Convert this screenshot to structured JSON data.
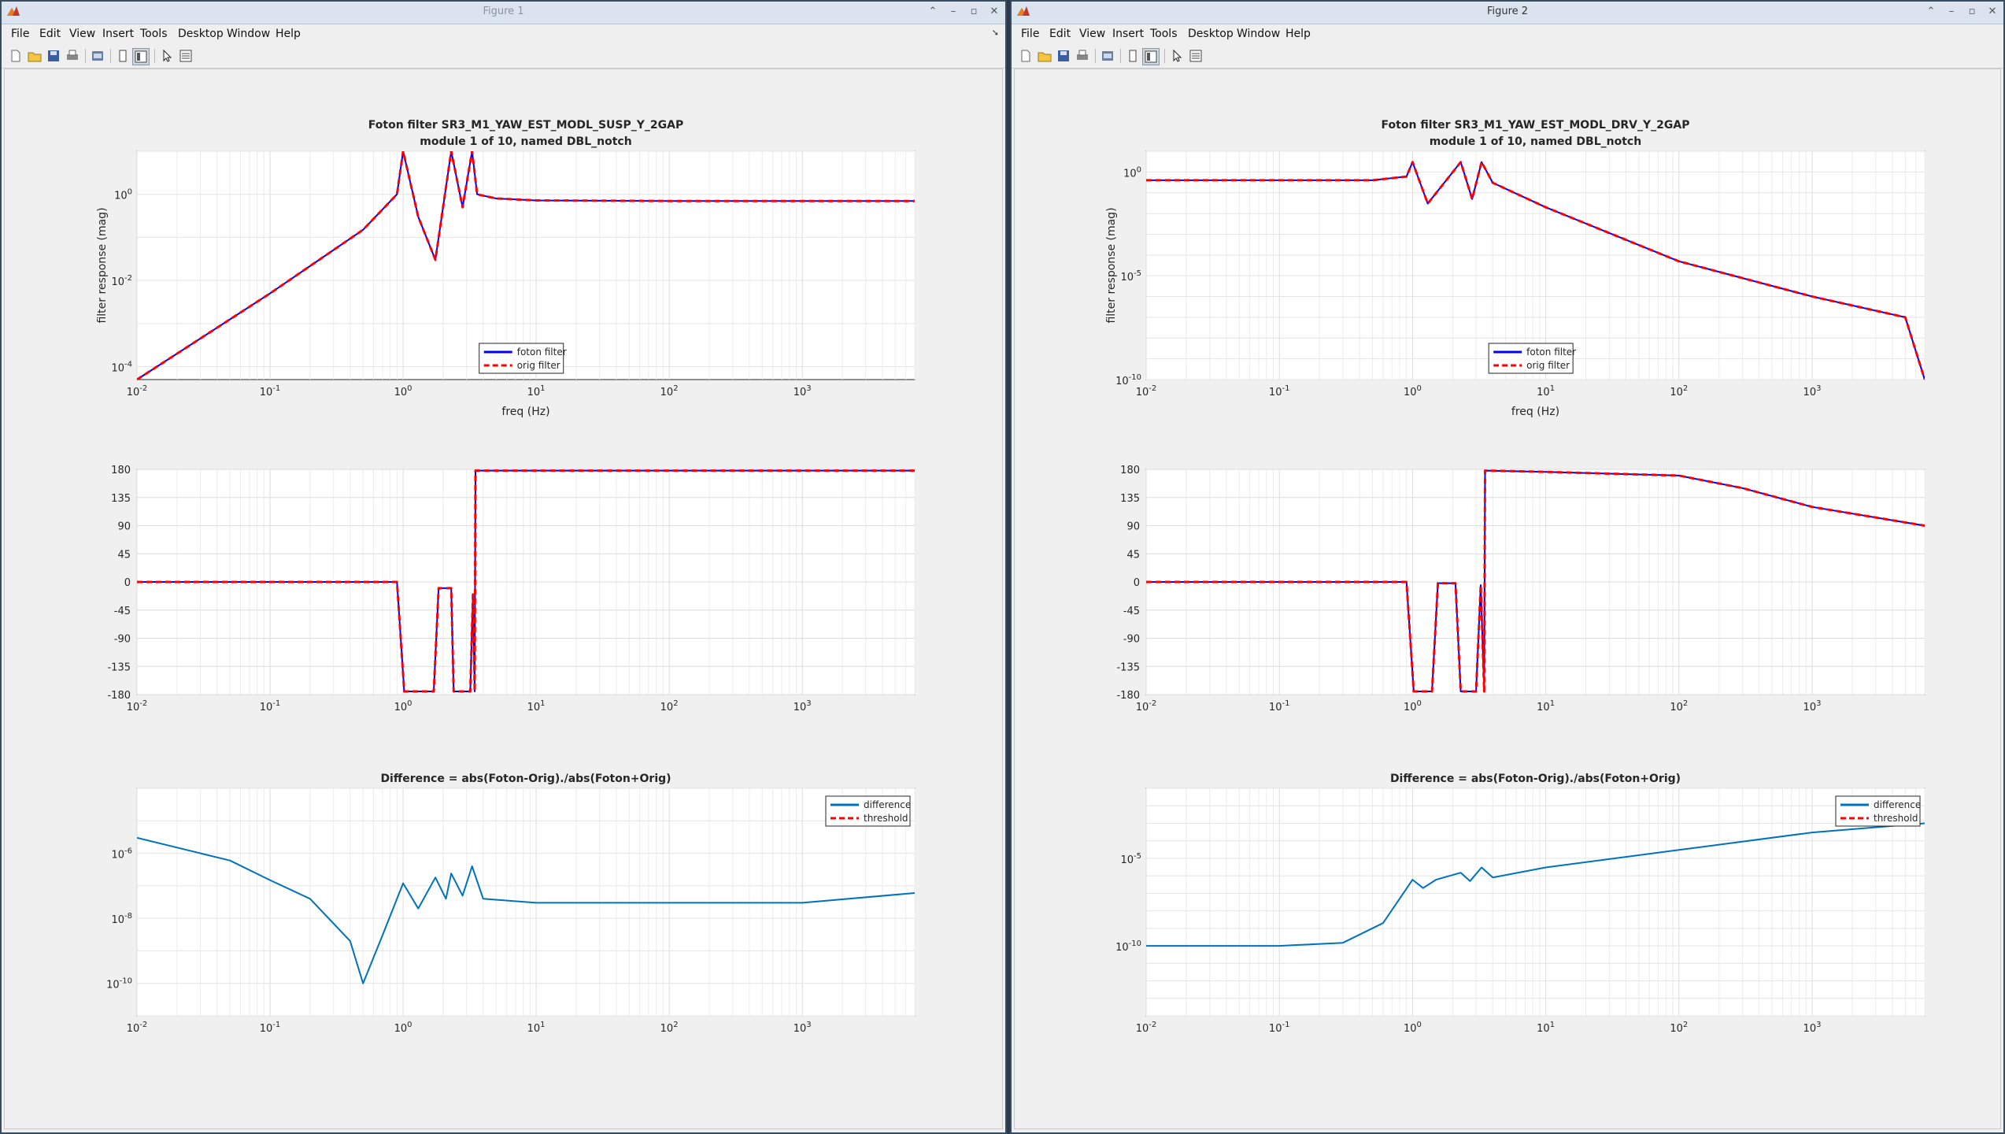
{
  "windows": [
    {
      "id": "win1",
      "title": "Figure 1",
      "menu": [
        "File",
        "Edit",
        "View",
        "Insert",
        "Tools",
        "Desktop",
        "Window",
        "Help"
      ],
      "plots": [
        {
          "key": "mag",
          "title_lines": [
            "Foton filter SR3_M1_YAW_EST_MODL_SUSP_Y_2GAP",
            "module 1 of 10, named DBL_notch"
          ],
          "ylabel": "filter response (mag)",
          "xlabel": "freq (Hz)",
          "xticks": [
            "10",
            "10",
            "10",
            "10",
            "10",
            "10"
          ],
          "xexp": [
            "-2",
            "-1",
            "0",
            "1",
            "2",
            "3"
          ],
          "yticks": [
            "10",
            "10",
            "10"
          ],
          "yexp": [
            "0",
            "-2",
            "-4"
          ],
          "legend": [
            "foton filter",
            "orig filter"
          ]
        },
        {
          "key": "phase",
          "yticks": [
            "180",
            "135",
            "90",
            "45",
            "0",
            "-45",
            "-90",
            "-135",
            "-180"
          ],
          "xticks": [
            "10",
            "10",
            "10",
            "10",
            "10",
            "10"
          ],
          "xexp": [
            "-2",
            "-1",
            "0",
            "1",
            "2",
            "3"
          ]
        },
        {
          "key": "diff",
          "title_lines": [
            "Difference = abs(Foton-Orig)./abs(Foton+Orig)"
          ],
          "xticks": [
            "10",
            "10",
            "10",
            "10",
            "10",
            "10"
          ],
          "xexp": [
            "-2",
            "-1",
            "0",
            "1",
            "2",
            "3"
          ],
          "yticks": [
            "10",
            "10",
            "10"
          ],
          "yexp": [
            "-6",
            "-8",
            "-10"
          ],
          "legend": [
            "difference",
            "threshold"
          ]
        }
      ]
    },
    {
      "id": "win2",
      "title": "Figure 2",
      "menu": [
        "File",
        "Edit",
        "View",
        "Insert",
        "Tools",
        "Desktop",
        "Window",
        "Help"
      ],
      "plots": [
        {
          "key": "mag",
          "title_lines": [
            "Foton filter SR3_M1_YAW_EST_MODL_DRV_Y_2GAP",
            "module 1 of 10, named DBL_notch"
          ],
          "ylabel": "filter response (mag)",
          "xlabel": "freq (Hz)",
          "xticks": [
            "10",
            "10",
            "10",
            "10",
            "10",
            "10"
          ],
          "xexp": [
            "-2",
            "-1",
            "0",
            "1",
            "2",
            "3"
          ],
          "yticks": [
            "10",
            "10",
            "10"
          ],
          "yexp": [
            "0",
            "-5",
            "-10"
          ],
          "legend": [
            "foton filter",
            "orig filter"
          ]
        },
        {
          "key": "phase",
          "yticks": [
            "180",
            "135",
            "90",
            "45",
            "0",
            "-45",
            "-90",
            "-135",
            "-180"
          ],
          "xticks": [
            "10",
            "10",
            "10",
            "10",
            "10",
            "10"
          ],
          "xexp": [
            "-2",
            "-1",
            "0",
            "1",
            "2",
            "3"
          ]
        },
        {
          "key": "diff",
          "title_lines": [
            "Difference = abs(Foton-Orig)./abs(Foton+Orig)"
          ],
          "xticks": [
            "10",
            "10",
            "10",
            "10",
            "10",
            "10"
          ],
          "xexp": [
            "-2",
            "-1",
            "0",
            "1",
            "2",
            "3"
          ],
          "yticks": [
            "10",
            "10"
          ],
          "yexp": [
            "-5",
            "-10"
          ],
          "legend": [
            "difference",
            "threshold"
          ]
        }
      ]
    }
  ],
  "chart_data": [
    {
      "type": "line",
      "title": "Foton filter SR3_M1_YAW_EST_MODL_SUSP_Y_2GAP / module 1 of 10, named DBL_notch",
      "xlabel": "freq (Hz)",
      "ylabel": "filter response (mag)",
      "xscale": "log",
      "yscale": "log",
      "xlim": [
        0.01,
        7000
      ],
      "ylim": [
        5e-05,
        10
      ],
      "grid": true,
      "legend": "bottom-center",
      "series": [
        {
          "name": "foton filter",
          "color": "#0000ff",
          "style": "solid",
          "x": [
            0.01,
            0.1,
            0.5,
            0.9,
            1.0,
            1.3,
            1.75,
            2.3,
            2.8,
            3.3,
            3.6,
            5,
            10,
            100,
            1000,
            7000
          ],
          "y": [
            5e-05,
            0.005,
            0.15,
            1.0,
            10,
            0.3,
            0.03,
            10,
            0.5,
            10,
            1.0,
            0.8,
            0.72,
            0.7,
            0.7,
            0.7
          ]
        },
        {
          "name": "orig filter",
          "color": "#ff0000",
          "style": "dashed",
          "x": [
            0.01,
            0.1,
            0.5,
            0.9,
            1.0,
            1.3,
            1.75,
            2.3,
            2.8,
            3.3,
            3.6,
            5,
            10,
            100,
            1000,
            7000
          ],
          "y": [
            5e-05,
            0.005,
            0.15,
            1.0,
            10,
            0.3,
            0.03,
            10,
            0.5,
            10,
            1.0,
            0.8,
            0.72,
            0.7,
            0.7,
            0.7
          ]
        }
      ]
    },
    {
      "type": "line",
      "xscale": "log",
      "xlim": [
        0.01,
        7000
      ],
      "ylim": [
        -180,
        180
      ],
      "grid": true,
      "series": [
        {
          "name": "foton filter",
          "color": "#0000ff",
          "style": "solid",
          "x": [
            0.01,
            0.9,
            1.02,
            1.7,
            1.85,
            2.3,
            2.4,
            3.2,
            3.35,
            3.45,
            3.5,
            10,
            100,
            1000,
            7000
          ],
          "y": [
            0,
            0,
            -175,
            -175,
            -10,
            -10,
            -175,
            -175,
            -20,
            -175,
            178,
            178,
            178,
            178,
            178
          ]
        },
        {
          "name": "orig filter",
          "color": "#ff0000",
          "style": "dashed",
          "x": [
            0.01,
            0.9,
            1.02,
            1.7,
            1.85,
            2.3,
            2.4,
            3.2,
            3.35,
            3.45,
            3.5,
            10,
            100,
            1000,
            7000
          ],
          "y": [
            0,
            0,
            -175,
            -175,
            -10,
            -10,
            -175,
            -175,
            -20,
            -175,
            178,
            178,
            178,
            178,
            178
          ]
        }
      ]
    },
    {
      "type": "line",
      "title": "Difference = abs(Foton-Orig)./abs(Foton+Orig)",
      "xscale": "log",
      "yscale": "log",
      "xlim": [
        0.01,
        7000
      ],
      "ylim": [
        1e-11,
        0.0001
      ],
      "grid": true,
      "legend": "top-right",
      "series": [
        {
          "name": "difference",
          "color": "#0072bd",
          "style": "solid",
          "x": [
            0.01,
            0.05,
            0.1,
            0.2,
            0.4,
            0.5,
            0.7,
            1.0,
            1.3,
            1.75,
            2.1,
            2.3,
            2.8,
            3.3,
            4,
            10,
            100,
            1000,
            7000
          ],
          "y": [
            3e-06,
            6e-07,
            1.5e-07,
            4e-08,
            2e-09,
            1e-10,
            3e-09,
            1.2e-07,
            2e-08,
            1.8e-07,
            4e-08,
            2.4e-07,
            5e-08,
            4e-07,
            4e-08,
            3e-08,
            3e-08,
            3e-08,
            6e-08
          ]
        },
        {
          "name": "threshold",
          "color": "#ff0000",
          "style": "dashed",
          "x": [],
          "y": []
        }
      ]
    },
    {
      "type": "line",
      "title": "Foton filter SR3_M1_YAW_EST_MODL_DRV_Y_2GAP / module 1 of 10, named DBL_notch",
      "xlabel": "freq (Hz)",
      "ylabel": "filter response (mag)",
      "xscale": "log",
      "yscale": "log",
      "xlim": [
        0.01,
        7000
      ],
      "ylim": [
        1e-10,
        10
      ],
      "grid": true,
      "legend": "bottom-center",
      "series": [
        {
          "name": "foton filter",
          "color": "#0000ff",
          "style": "solid",
          "x": [
            0.01,
            0.5,
            0.9,
            1.0,
            1.3,
            2.3,
            2.8,
            3.3,
            4,
            10,
            100,
            1000,
            5000,
            7000
          ],
          "y": [
            0.4,
            0.4,
            0.6,
            3,
            0.03,
            3,
            0.05,
            3,
            0.3,
            0.02,
            5e-05,
            1e-06,
            1e-07,
            1e-10
          ]
        },
        {
          "name": "orig filter",
          "color": "#ff0000",
          "style": "dashed",
          "x": [
            0.01,
            0.5,
            0.9,
            1.0,
            1.3,
            2.3,
            2.8,
            3.3,
            4,
            10,
            100,
            1000,
            5000,
            7000
          ],
          "y": [
            0.4,
            0.4,
            0.6,
            3,
            0.03,
            3,
            0.05,
            3,
            0.3,
            0.02,
            5e-05,
            1e-06,
            1e-07,
            1e-10
          ]
        }
      ]
    },
    {
      "type": "line",
      "xscale": "log",
      "xlim": [
        0.01,
        7000
      ],
      "ylim": [
        -180,
        180
      ],
      "grid": true,
      "series": [
        {
          "name": "foton filter",
          "color": "#0000ff",
          "style": "solid",
          "x": [
            0.01,
            0.9,
            1.02,
            1.4,
            1.55,
            2.1,
            2.3,
            3.0,
            3.25,
            3.45,
            3.5,
            10,
            100,
            300,
            1000,
            7000
          ],
          "y": [
            0,
            0,
            -175,
            -175,
            -2,
            -2,
            -175,
            -175,
            -5,
            -175,
            178,
            176,
            170,
            150,
            120,
            90
          ]
        },
        {
          "name": "orig filter",
          "color": "#ff0000",
          "style": "dashed",
          "x": [
            0.01,
            0.9,
            1.02,
            1.4,
            1.55,
            2.1,
            2.3,
            3.0,
            3.25,
            3.45,
            3.5,
            10,
            100,
            300,
            1000,
            7000
          ],
          "y": [
            0,
            0,
            -175,
            -175,
            -2,
            -2,
            -175,
            -175,
            -5,
            -175,
            178,
            176,
            170,
            150,
            120,
            90
          ]
        }
      ]
    },
    {
      "type": "line",
      "title": "Difference = abs(Foton-Orig)./abs(Foton+Orig)",
      "xscale": "log",
      "yscale": "log",
      "xlim": [
        0.01,
        7000
      ],
      "ylim": [
        1e-14,
        0.1
      ],
      "grid": true,
      "legend": "top-right",
      "series": [
        {
          "name": "difference",
          "color": "#0072bd",
          "style": "solid",
          "x": [
            0.01,
            0.1,
            0.3,
            0.6,
            1.0,
            1.2,
            1.5,
            2.3,
            2.7,
            3.3,
            4,
            10,
            100,
            1000,
            7000
          ],
          "y": [
            1e-10,
            1e-10,
            1.5e-10,
            2e-09,
            6e-07,
            2e-07,
            6e-07,
            1.5e-06,
            5e-07,
            3e-06,
            8e-07,
            3e-06,
            3e-05,
            0.0003,
            0.001
          ]
        },
        {
          "name": "threshold",
          "color": "#ff0000",
          "style": "dashed",
          "x": [],
          "y": []
        }
      ]
    }
  ]
}
